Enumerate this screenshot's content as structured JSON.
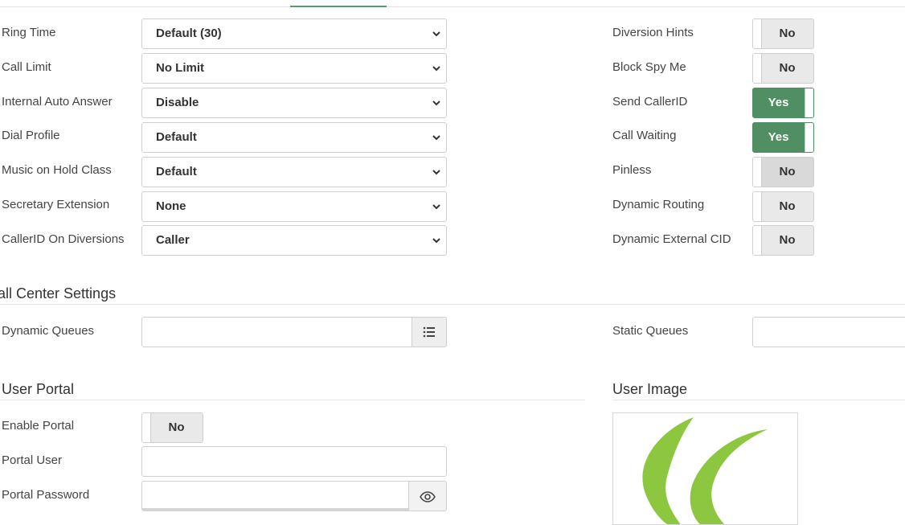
{
  "left_fields": [
    {
      "label": "Ring Time",
      "value": "Default (30)"
    },
    {
      "label": "Call Limit",
      "value": "No Limit"
    },
    {
      "label": "Internal Auto Answer",
      "value": "Disable"
    },
    {
      "label": "Dial Profile",
      "value": "Default"
    },
    {
      "label": "Music on Hold Class",
      "value": "Default"
    },
    {
      "label": "Secretary Extension",
      "value": "None"
    },
    {
      "label": "CallerID On Diversions",
      "value": "Caller"
    }
  ],
  "right_toggles": [
    {
      "label": "Diversion Hints",
      "value": "No"
    },
    {
      "label": "Block Spy Me",
      "value": "No"
    },
    {
      "label": "Send CallerID",
      "value": "Yes"
    },
    {
      "label": "Call Waiting",
      "value": "Yes"
    },
    {
      "label": "Pinless",
      "value": "No"
    },
    {
      "label": "Dynamic Routing",
      "value": "No"
    },
    {
      "label": "Dynamic External CID",
      "value": "No"
    }
  ],
  "call_center": {
    "title": "all Center Settings",
    "dynamic_queues_label": "Dynamic Queues",
    "dynamic_queues_value": "",
    "static_queues_label": "Static Queues",
    "static_queues_value": ""
  },
  "user_portal": {
    "title": "User Portal",
    "enable_label": "Enable Portal",
    "enable_value": "No",
    "user_label": "Portal User",
    "user_value": "",
    "password_label": "Portal Password",
    "password_value": ""
  },
  "user_image": {
    "title": "User Image",
    "logo_color": "#8dc63f"
  },
  "colors": {
    "toggle_on": "#4f8f63",
    "toggle_off": "#e9e9e9",
    "accent": "#5a9a6e"
  }
}
